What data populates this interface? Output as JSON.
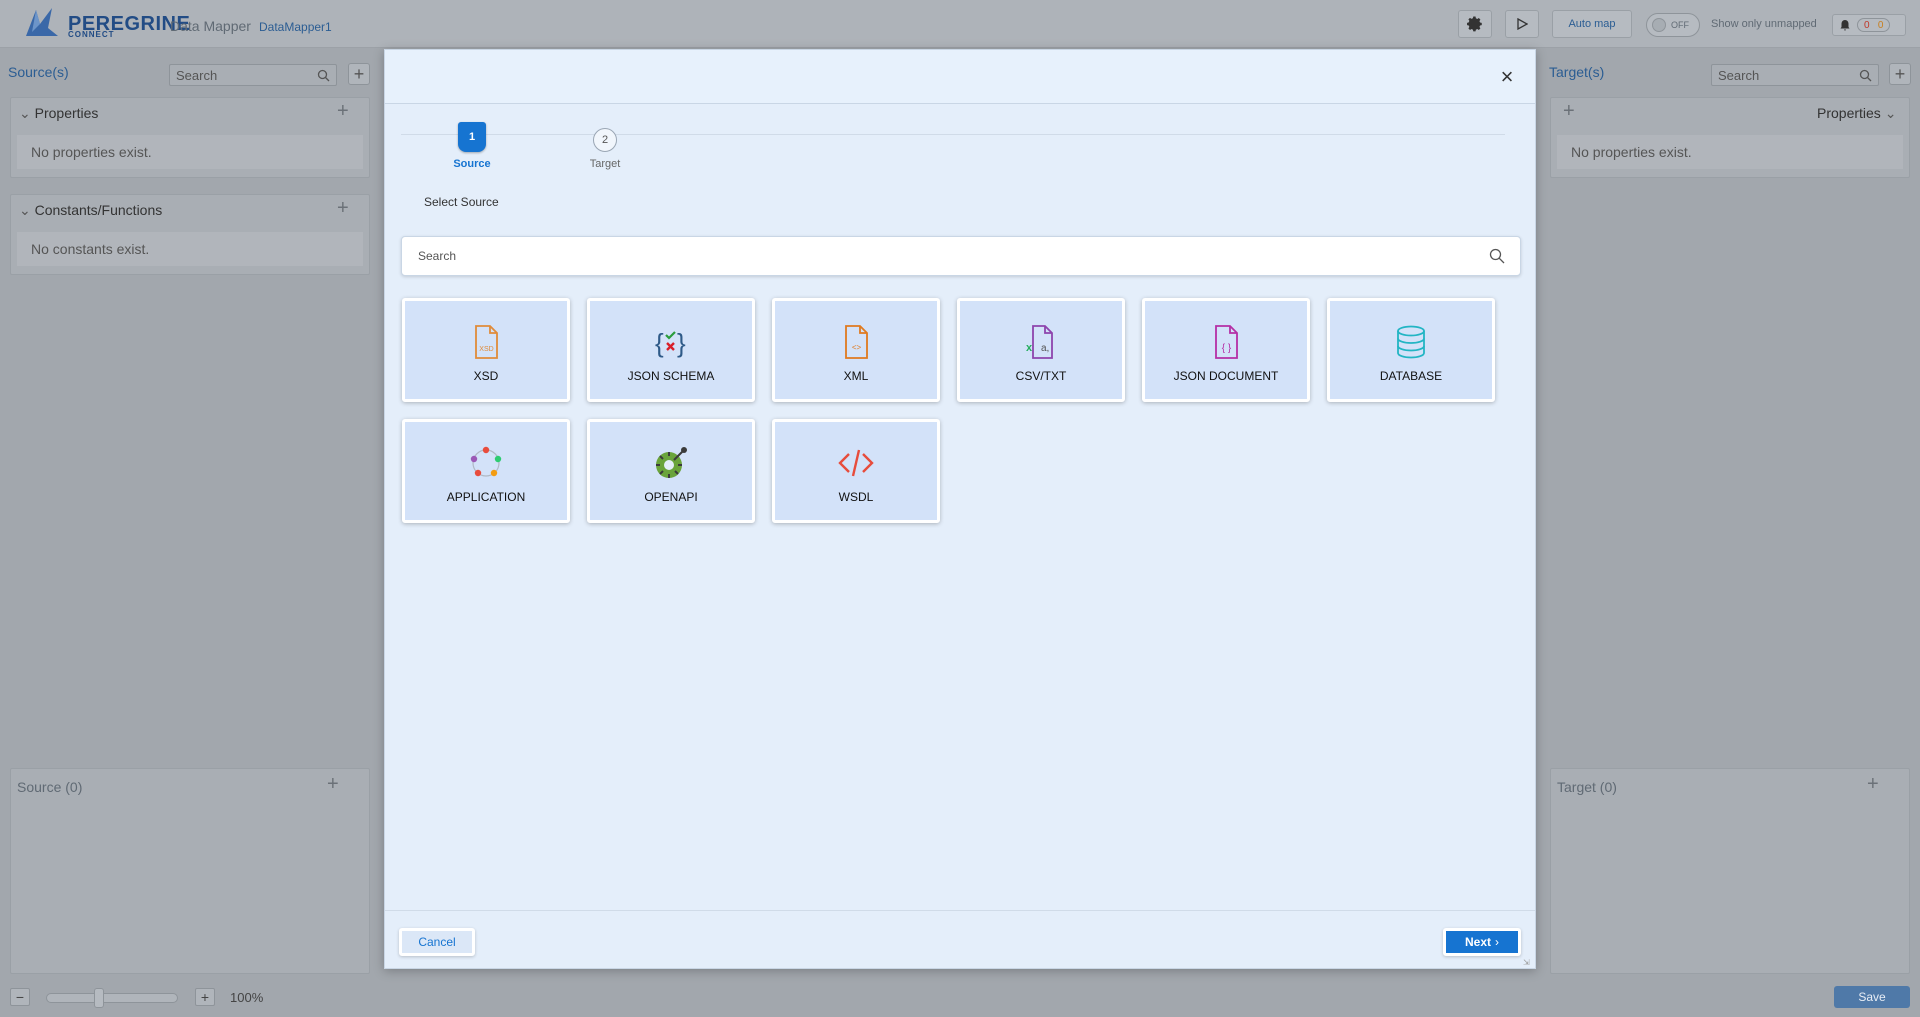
{
  "header": {
    "logo_text": "PEREGRINE",
    "logo_sub": "CONNECT",
    "app_name": "Data Mapper",
    "doc_name": "DataMapper1",
    "auto_map_label": "Auto map",
    "toggle_label": "OFF",
    "show_unmapped_label": "Show only unmapped",
    "error_count": "0",
    "warning_count": "0"
  },
  "left_panel": {
    "title": "Source(s)",
    "search_placeholder": "Search",
    "properties_title": "Properties",
    "properties_empty": "No properties exist.",
    "constants_title": "Constants/Functions",
    "constants_empty": "No constants exist.",
    "footer_title": "Source (0)"
  },
  "right_panel": {
    "title": "Target(s)",
    "search_placeholder": "Search",
    "properties_title": "Properties",
    "properties_empty": "No properties exist.",
    "footer_title": "Target (0)"
  },
  "bottom_bar": {
    "zoom_value": "100%",
    "zoom_level_fraction": 0.33,
    "save_label": "Save"
  },
  "modal": {
    "steps": [
      {
        "number": "1",
        "label": "Source",
        "active": true
      },
      {
        "number": "2",
        "label": "Target",
        "active": false
      }
    ],
    "section_title": "Select Source",
    "search_placeholder": "Search",
    "tiles": [
      {
        "label": "XSD",
        "icon": "xsd-file-icon"
      },
      {
        "label": "JSON SCHEMA",
        "icon": "json-schema-icon"
      },
      {
        "label": "XML",
        "icon": "xml-file-icon"
      },
      {
        "label": "CSV/TXT",
        "icon": "csv-file-icon"
      },
      {
        "label": "JSON DOCUMENT",
        "icon": "json-document-icon"
      },
      {
        "label": "DATABASE",
        "icon": "database-icon"
      },
      {
        "label": "APPLICATION",
        "icon": "application-icon"
      },
      {
        "label": "OPENAPI",
        "icon": "openapi-icon"
      },
      {
        "label": "WSDL",
        "icon": "wsdl-code-icon"
      }
    ],
    "cancel_label": "Cancel",
    "next_label": "Next"
  },
  "colors": {
    "accent": "#1674d1",
    "tile_bg": "#d3e2f9",
    "modal_bg": "#e4eefa",
    "overlay_bg": "#a2a7ad"
  }
}
